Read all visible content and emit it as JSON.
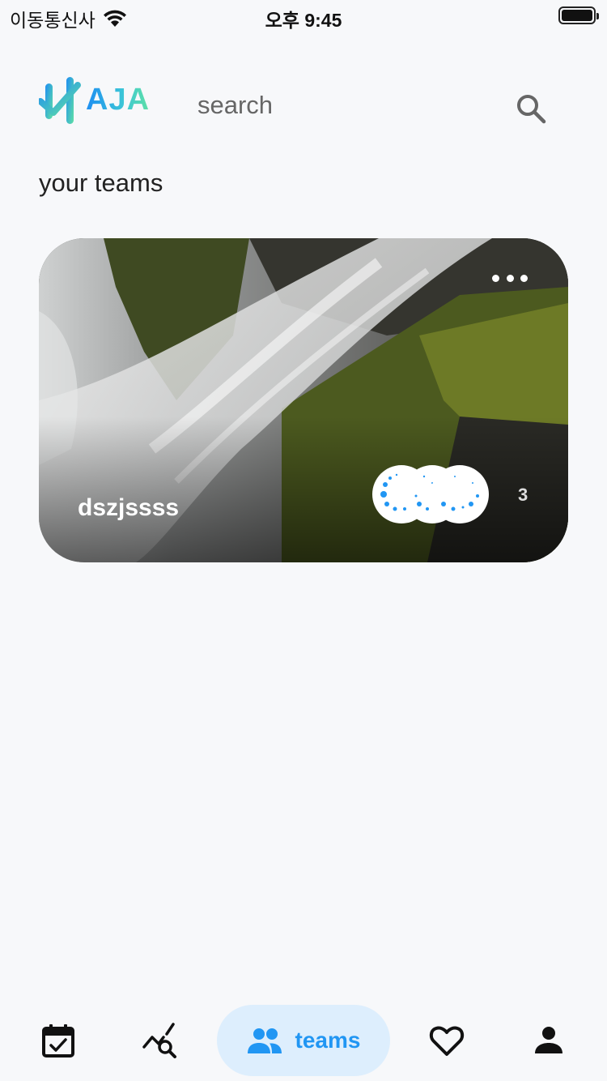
{
  "status_bar": {
    "carrier": "이동통신사",
    "time": "오후 9:45"
  },
  "header": {
    "logo_text": "AJA",
    "search_placeholder": "search"
  },
  "section_title": "your teams",
  "team_card": {
    "name": "dszjssss",
    "member_count": "3"
  },
  "bottom_nav": {
    "items": [
      {
        "icon": "calendar-check-icon",
        "active": false
      },
      {
        "icon": "chart-search-icon",
        "active": false
      },
      {
        "icon": "people-icon",
        "label": "teams",
        "active": true
      },
      {
        "icon": "heart-icon",
        "active": false
      },
      {
        "icon": "person-icon",
        "active": false
      }
    ]
  },
  "colors": {
    "accent": "#2196f3",
    "active_pill": "#ddeefd",
    "background": "#f7f8fa"
  }
}
